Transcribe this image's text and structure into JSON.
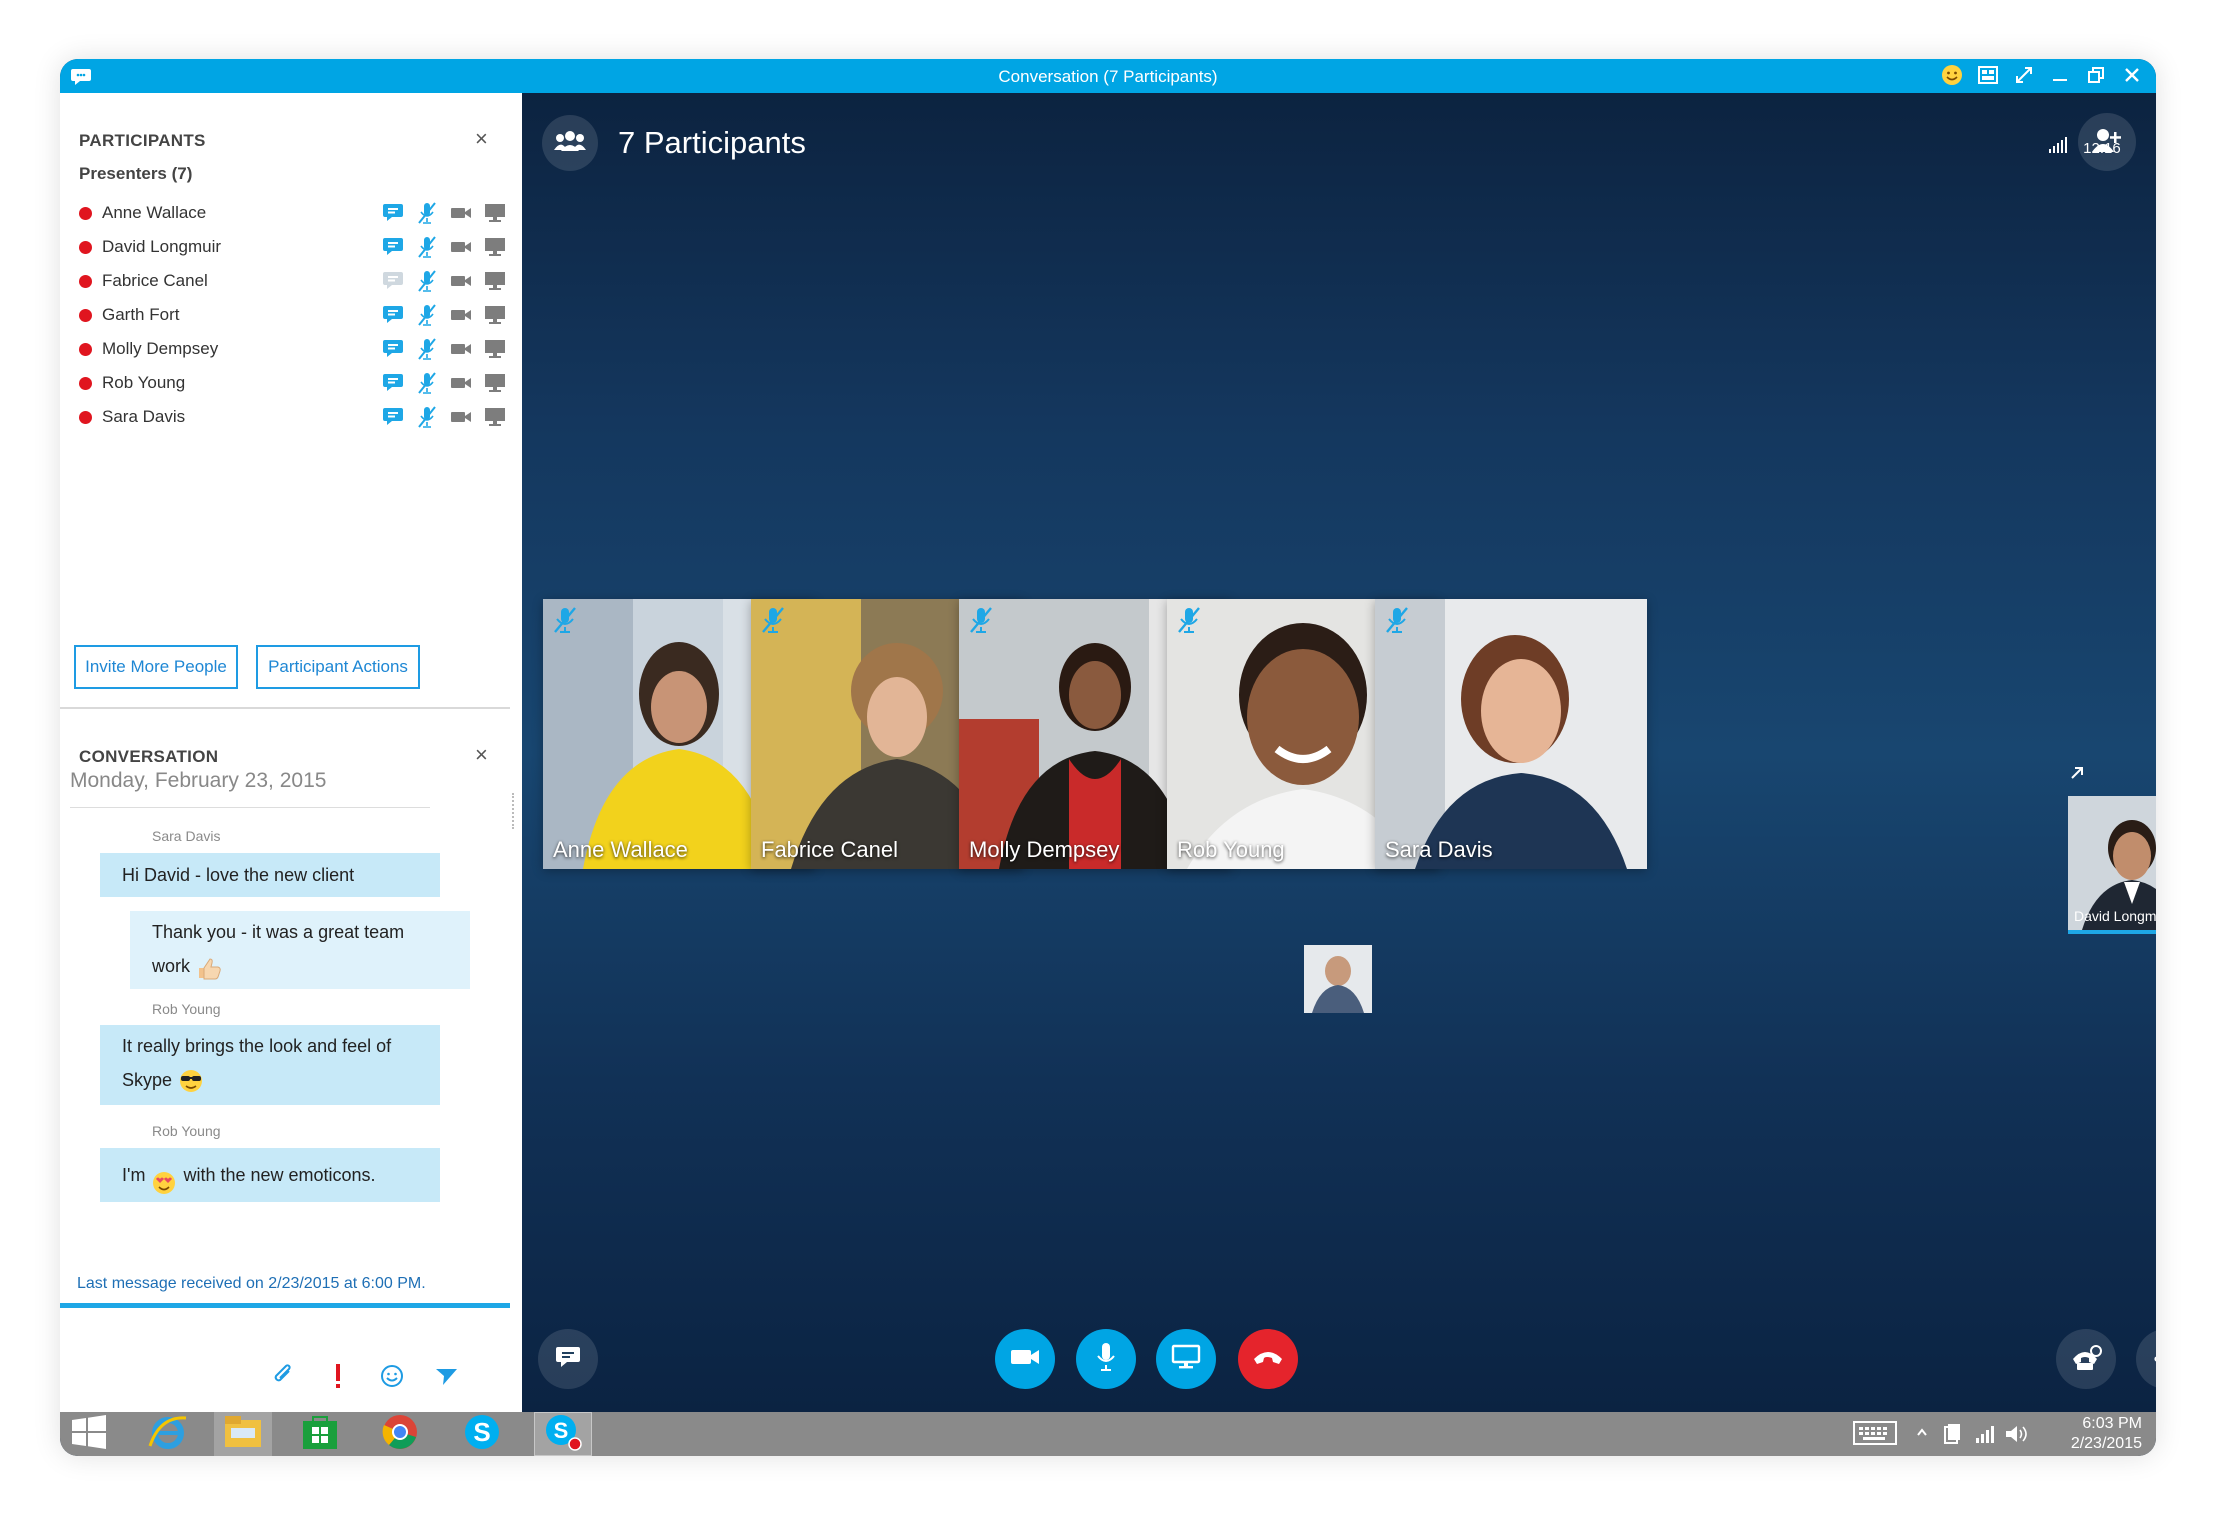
{
  "window": {
    "title": "Conversation (7 Participants)"
  },
  "participants_panel": {
    "title": "PARTICIPANTS",
    "close": "×",
    "group_label": "Presenters (7)",
    "people": [
      {
        "name": "Anne Wallace",
        "chat_active": true
      },
      {
        "name": "David Longmuir",
        "chat_active": true
      },
      {
        "name": "Fabrice Canel",
        "chat_active": false
      },
      {
        "name": "Garth Fort",
        "chat_active": true
      },
      {
        "name": "Molly Dempsey",
        "chat_active": true
      },
      {
        "name": "Rob Young",
        "chat_active": true
      },
      {
        "name": "Sara Davis",
        "chat_active": true
      }
    ],
    "invite_button": "Invite More People",
    "actions_button": "Participant Actions"
  },
  "conversation_panel": {
    "title": "CONVERSATION",
    "close": "×",
    "date": "Monday, February 23, 2015",
    "messages": [
      {
        "sender": "Sara Davis",
        "text": "Hi David - love the new client"
      },
      {
        "sender": "",
        "line1": "Thank you - it was a great team",
        "line2": "work"
      },
      {
        "sender": "Rob Young",
        "line1": "It really brings the look and feel of",
        "line2": "Skype"
      },
      {
        "sender": "Rob Young",
        "pre": "I'm",
        "post": "with the new emoticons."
      }
    ],
    "last_message": "Last message received on 2/23/2015 at 6:00 PM."
  },
  "stage": {
    "header_title": "7 Participants",
    "time": "12:16",
    "tiles": [
      {
        "name": "Anne Wallace",
        "muted": true
      },
      {
        "name": "Fabrice Canel",
        "muted": true
      },
      {
        "name": "Molly Dempsey",
        "muted": true
      },
      {
        "name": "Rob Young",
        "muted": true
      },
      {
        "name": "Sara Davis",
        "muted": true
      }
    ],
    "active_speaker": {
      "name": "David Longmuir"
    }
  },
  "taskbar": {
    "time": "6:03 PM",
    "date": "2/23/2015"
  },
  "colors": {
    "accent": "#00a5e4",
    "presence_busy": "#e0151f",
    "hangup": "#e5242c",
    "call_button": "#00a5e4"
  }
}
